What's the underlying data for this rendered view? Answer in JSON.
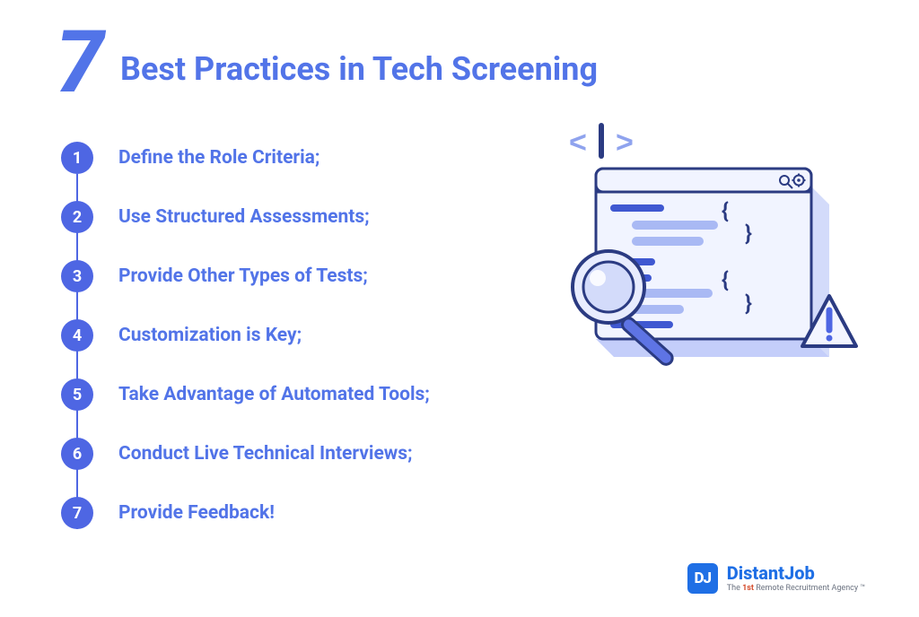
{
  "header": {
    "number": "7",
    "title": "Best Practices in Tech Screening"
  },
  "items": [
    {
      "n": "1",
      "text": "Define the Role Criteria;"
    },
    {
      "n": "2",
      "text": "Use Structured Assessments;"
    },
    {
      "n": "3",
      "text": "Provide Other Types of Tests;"
    },
    {
      "n": "4",
      "text": "Customization is Key;"
    },
    {
      "n": "5",
      "text": "Take Advantage of Automated Tools;"
    },
    {
      "n": "6",
      "text": "Conduct Live Technical Interviews;"
    },
    {
      "n": "7",
      "text": "Provide Feedback!"
    }
  ],
  "brand": {
    "mark": "DJ",
    "name": "DistantJob",
    "tag_prefix": "The ",
    "tag_first": "1st",
    "tag_rest": " Remote Recruitment Agency ™"
  },
  "illustration": {
    "code_glyphs": "< | >",
    "icons": [
      "search-icon",
      "gear-icon"
    ]
  },
  "colors": {
    "primary": "#5274E8",
    "bullet": "#4E66E3",
    "brand": "#1F6FE5",
    "accentLight": "#A9B9F4",
    "lineDark": "#2B3B82"
  }
}
